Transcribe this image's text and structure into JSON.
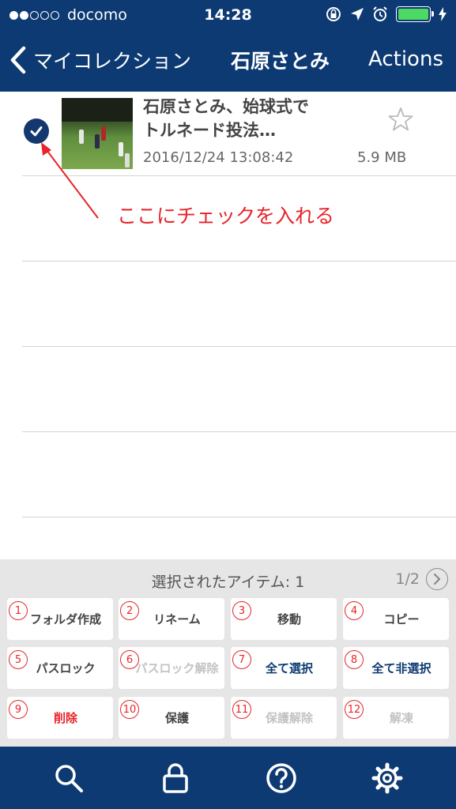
{
  "status_bar": {
    "carrier": "docomo",
    "time": "14:28",
    "signal_dots_filled": 2,
    "signal_dots_total": 5
  },
  "nav": {
    "back_label": "マイコレクション",
    "title": "石原さとみ",
    "actions_label": "Actions"
  },
  "items": [
    {
      "title": "石原さとみ、始球式でトルネード投法…",
      "date": "2016/12/24 13:08:42",
      "size": "5.9 MB",
      "checked": true,
      "starred": false
    }
  ],
  "annotation": "ここにチェックを入れる",
  "panel": {
    "selected_label": "選択されたアイテム: 1",
    "page": "1/2"
  },
  "buttons": [
    {
      "num": "1",
      "label": "フォルダ作成",
      "state": "dark"
    },
    {
      "num": "2",
      "label": "リネーム",
      "state": "dark"
    },
    {
      "num": "3",
      "label": "移動",
      "state": "dark"
    },
    {
      "num": "4",
      "label": "コピー",
      "state": "dark"
    },
    {
      "num": "5",
      "label": "パスロック",
      "state": "dark"
    },
    {
      "num": "6",
      "label": "パスロック解除",
      "state": "disabled"
    },
    {
      "num": "7",
      "label": "全て選択",
      "state": "blue"
    },
    {
      "num": "8",
      "label": "全て非選択",
      "state": "blue"
    },
    {
      "num": "9",
      "label": "削除",
      "state": "red"
    },
    {
      "num": "10",
      "label": "保護",
      "state": "dark"
    },
    {
      "num": "11",
      "label": "保護解除",
      "state": "disabled"
    },
    {
      "num": "12",
      "label": "解凍",
      "state": "disabled"
    }
  ],
  "tab_bar": {
    "tabs": [
      "search-icon",
      "lock-icon",
      "help-icon",
      "gear-icon"
    ]
  },
  "colors": {
    "nav_blue": "#0d3a72",
    "annotation_red": "#e8232a",
    "battery_green": "#4cd964"
  }
}
